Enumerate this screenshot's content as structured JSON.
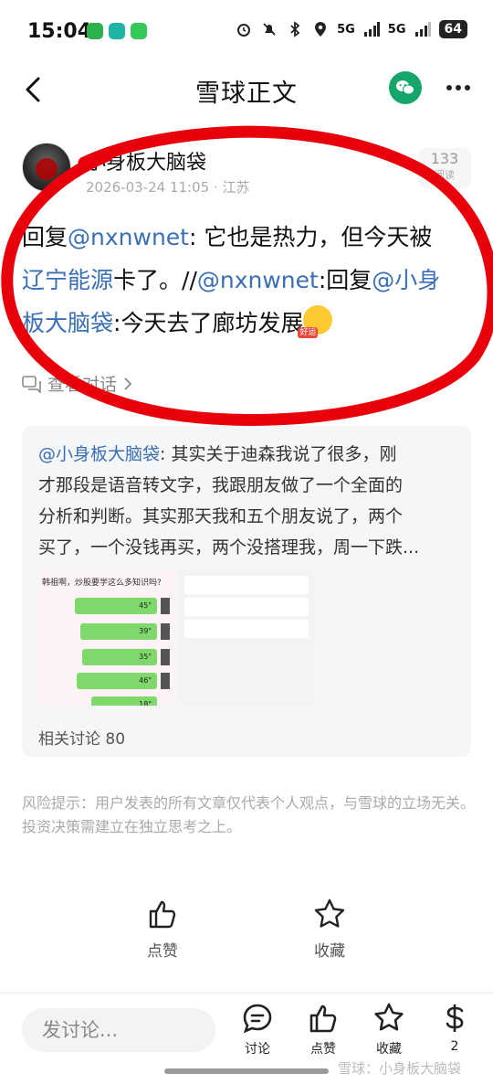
{
  "status_bar": {
    "time": "15:04",
    "network_1": "5G",
    "network_2": "5G",
    "battery": "64"
  },
  "nav": {
    "title": "雪球正文"
  },
  "post": {
    "author": "小身板大脑袋",
    "meta": "2026-03-24 11:05 · 江苏",
    "views_count": "133",
    "views_label": "阅读",
    "line1": {
      "prefix": "回复",
      "mention": "@nxnwnet",
      "text": ": 它也是热力，但今天被"
    },
    "line2": {
      "mention1": "辽宁能源",
      "text1": "卡了。//",
      "mention2": "@nxnwnet",
      "text2": ":回复",
      "mention3": "@小身"
    },
    "line3": {
      "mention": "板大脑袋",
      "text": ":今天去了廊坊发展"
    },
    "emoji_tag": "好运",
    "view_conversation": "查看对话"
  },
  "quote": {
    "line1_mention": "@小身板大脑袋",
    "line1_text": ": 其实关于迪森我说了很多，刚",
    "line2": "才那段是语音转文字，我跟朋友做了一个全面的",
    "line3": "分析和判断。其实那天我和五个朋友说了，两个",
    "line4": "买了，一个没钱再买，两个没搭理我，周一下跌...",
    "image1_caption": "韩祖啊，炒股要学这么多知识吗?",
    "bubbles": [
      "45\"",
      "39\"",
      "35\"",
      "46\"",
      "18\""
    ],
    "related": "相关讨论 80"
  },
  "risk": {
    "text": "风险提示：用户发表的所有文章仅代表个人观点，与雪球的立场无关。投资决策需建立在独立思考之上。"
  },
  "actions": {
    "like": "点赞",
    "favorite": "收藏"
  },
  "bottom_bar": {
    "input_placeholder": "发讨论...",
    "discuss": "讨论",
    "like": "点赞",
    "favorite": "收藏",
    "reward": "2"
  },
  "watermark": "雪球：小身板大脑袋",
  "colors": {
    "accent_link": "#3a6fb5",
    "wechat_green": "#16a56a",
    "annotation_red": "#e8000a"
  }
}
